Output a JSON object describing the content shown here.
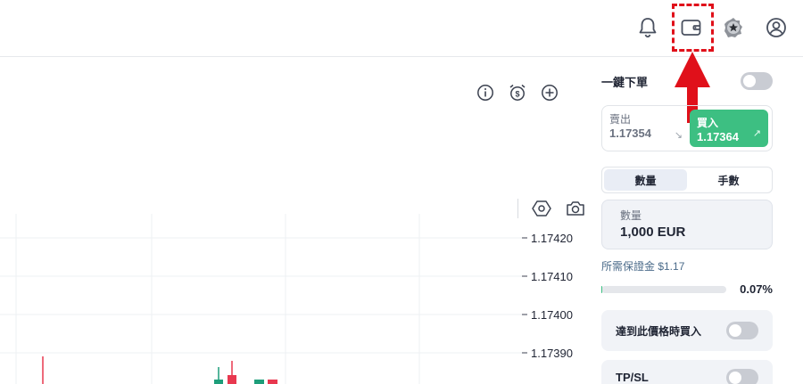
{
  "topbar": {
    "icons": [
      "bell-icon",
      "wallet-icon",
      "medal-icon",
      "user-icon"
    ]
  },
  "chart": {
    "price_labels": [
      "1.17420",
      "1.17410",
      "1.17400",
      "1.17390"
    ],
    "tool_icons": [
      "info-icon",
      "alarm-dollar-icon",
      "plus-circle-icon"
    ],
    "tool_icons2": [
      "hexagon-settings-icon",
      "camera-icon"
    ]
  },
  "panel": {
    "one_click_label": "一鍵下單",
    "sell": {
      "label": "賣出",
      "price": "1.17354",
      "arrow": "↘"
    },
    "buy": {
      "label": "買入",
      "price": "1.17364",
      "arrow": "↗"
    },
    "tabs": {
      "quantity": "數量",
      "lots": "手數"
    },
    "quantity": {
      "label": "數量",
      "value": "1,000 EUR"
    },
    "margin_text": "所需保證金 $1.17",
    "margin_pct": "0.07%",
    "margin_fraction": 0.07,
    "limit_label": "達到此價格時買入",
    "tpsl_label": "TP/SL"
  },
  "colors": {
    "buy": "#3dbf82",
    "annotation": "#e0101a",
    "up_candle": "#1e9e7a",
    "down_candle": "#e8384f"
  }
}
